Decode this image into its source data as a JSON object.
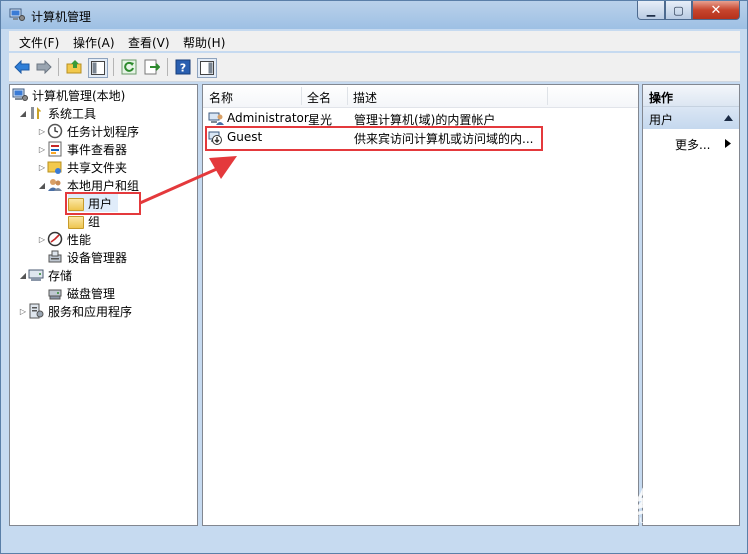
{
  "window": {
    "title": "计算机管理",
    "buttons": {
      "minimize": "▁",
      "maximize": "▢",
      "close": "✕"
    }
  },
  "menu": [
    "文件(F)",
    "操作(A)",
    "查看(V)",
    "帮助(H)"
  ],
  "toolbar": {
    "icons": [
      "back-arrow-icon",
      "forward-arrow-icon",
      "up-folder-icon",
      "show-hide-tree-icon",
      "refresh-icon",
      "export-list-icon",
      "help-icon",
      "action-pane-icon"
    ]
  },
  "tree": {
    "root": "计算机管理(本地)",
    "system_tools": "系统工具",
    "task_scheduler": "任务计划程序",
    "event_viewer": "事件查看器",
    "shared_folders": "共享文件夹",
    "local_users_groups": "本地用户和组",
    "users": "用户",
    "groups": "组",
    "performance": "性能",
    "device_manager": "设备管理器",
    "storage": "存储",
    "disk_management": "磁盘管理",
    "services_apps": "服务和应用程序"
  },
  "list": {
    "columns": [
      "名称",
      "全名",
      "描述"
    ],
    "rows": [
      {
        "name": "Administrator",
        "fullname": "星光",
        "desc": "管理计算机(域)的内置帐户"
      },
      {
        "name": "Guest",
        "fullname": "",
        "desc": "供来宾访问计算机或访问域的内..."
      }
    ]
  },
  "actions": {
    "header": "操作",
    "section": "用户",
    "more": "更多..."
  },
  "watermark": {
    "brand": "Bai 经验",
    "url": "jingyan.baidu.com"
  },
  "colors": {
    "highlight": "#e4393c",
    "titlebar": "#9ec0e4",
    "selected": "#e0ecfa"
  }
}
